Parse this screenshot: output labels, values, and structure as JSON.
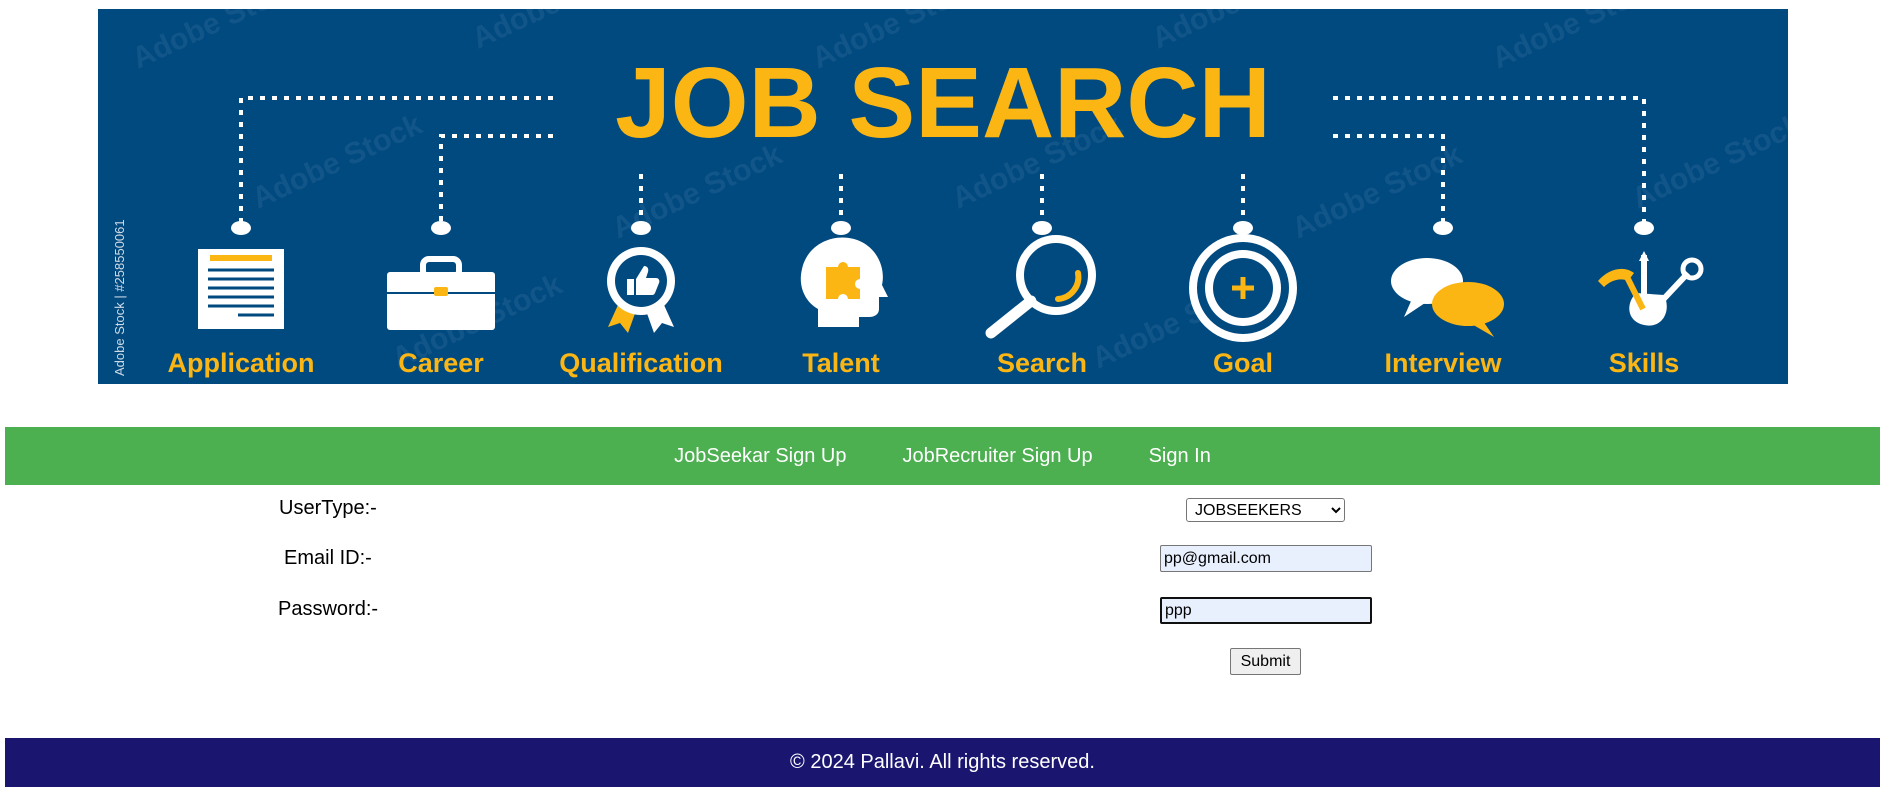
{
  "banner": {
    "title": "JOB SEARCH",
    "watermark": "Adobe Stock",
    "side_text": "Adobe Stock | #258550061",
    "colors": {
      "background": "#004a80",
      "accent": "#fbb614",
      "icon": "#ffffff"
    },
    "items": [
      {
        "label": "Application",
        "icon": "document-icon"
      },
      {
        "label": "Career",
        "icon": "briefcase-icon"
      },
      {
        "label": "Qualification",
        "icon": "award-ribbon-icon"
      },
      {
        "label": "Talent",
        "icon": "head-puzzle-icon"
      },
      {
        "label": "Search",
        "icon": "magnifier-icon"
      },
      {
        "label": "Goal",
        "icon": "target-icon"
      },
      {
        "label": "Interview",
        "icon": "speech-bubbles-icon"
      },
      {
        "label": "Skills",
        "icon": "tools-icon"
      }
    ]
  },
  "nav": {
    "color": "#4caf50",
    "items": [
      "JobSeekar Sign Up",
      "JobRecruiter Sign Up",
      "Sign In"
    ]
  },
  "form": {
    "usertype_label": "UserType:-",
    "usertype_value": "JOBSEEKERS",
    "email_label": "Email ID:-",
    "email_value": "pp@gmail.com",
    "password_label": "Password:-",
    "password_value": "ppp",
    "submit_label": "Submit"
  },
  "footer": {
    "text": "© 2024 Pallavi. All rights reserved.",
    "color": "#1a1670"
  }
}
